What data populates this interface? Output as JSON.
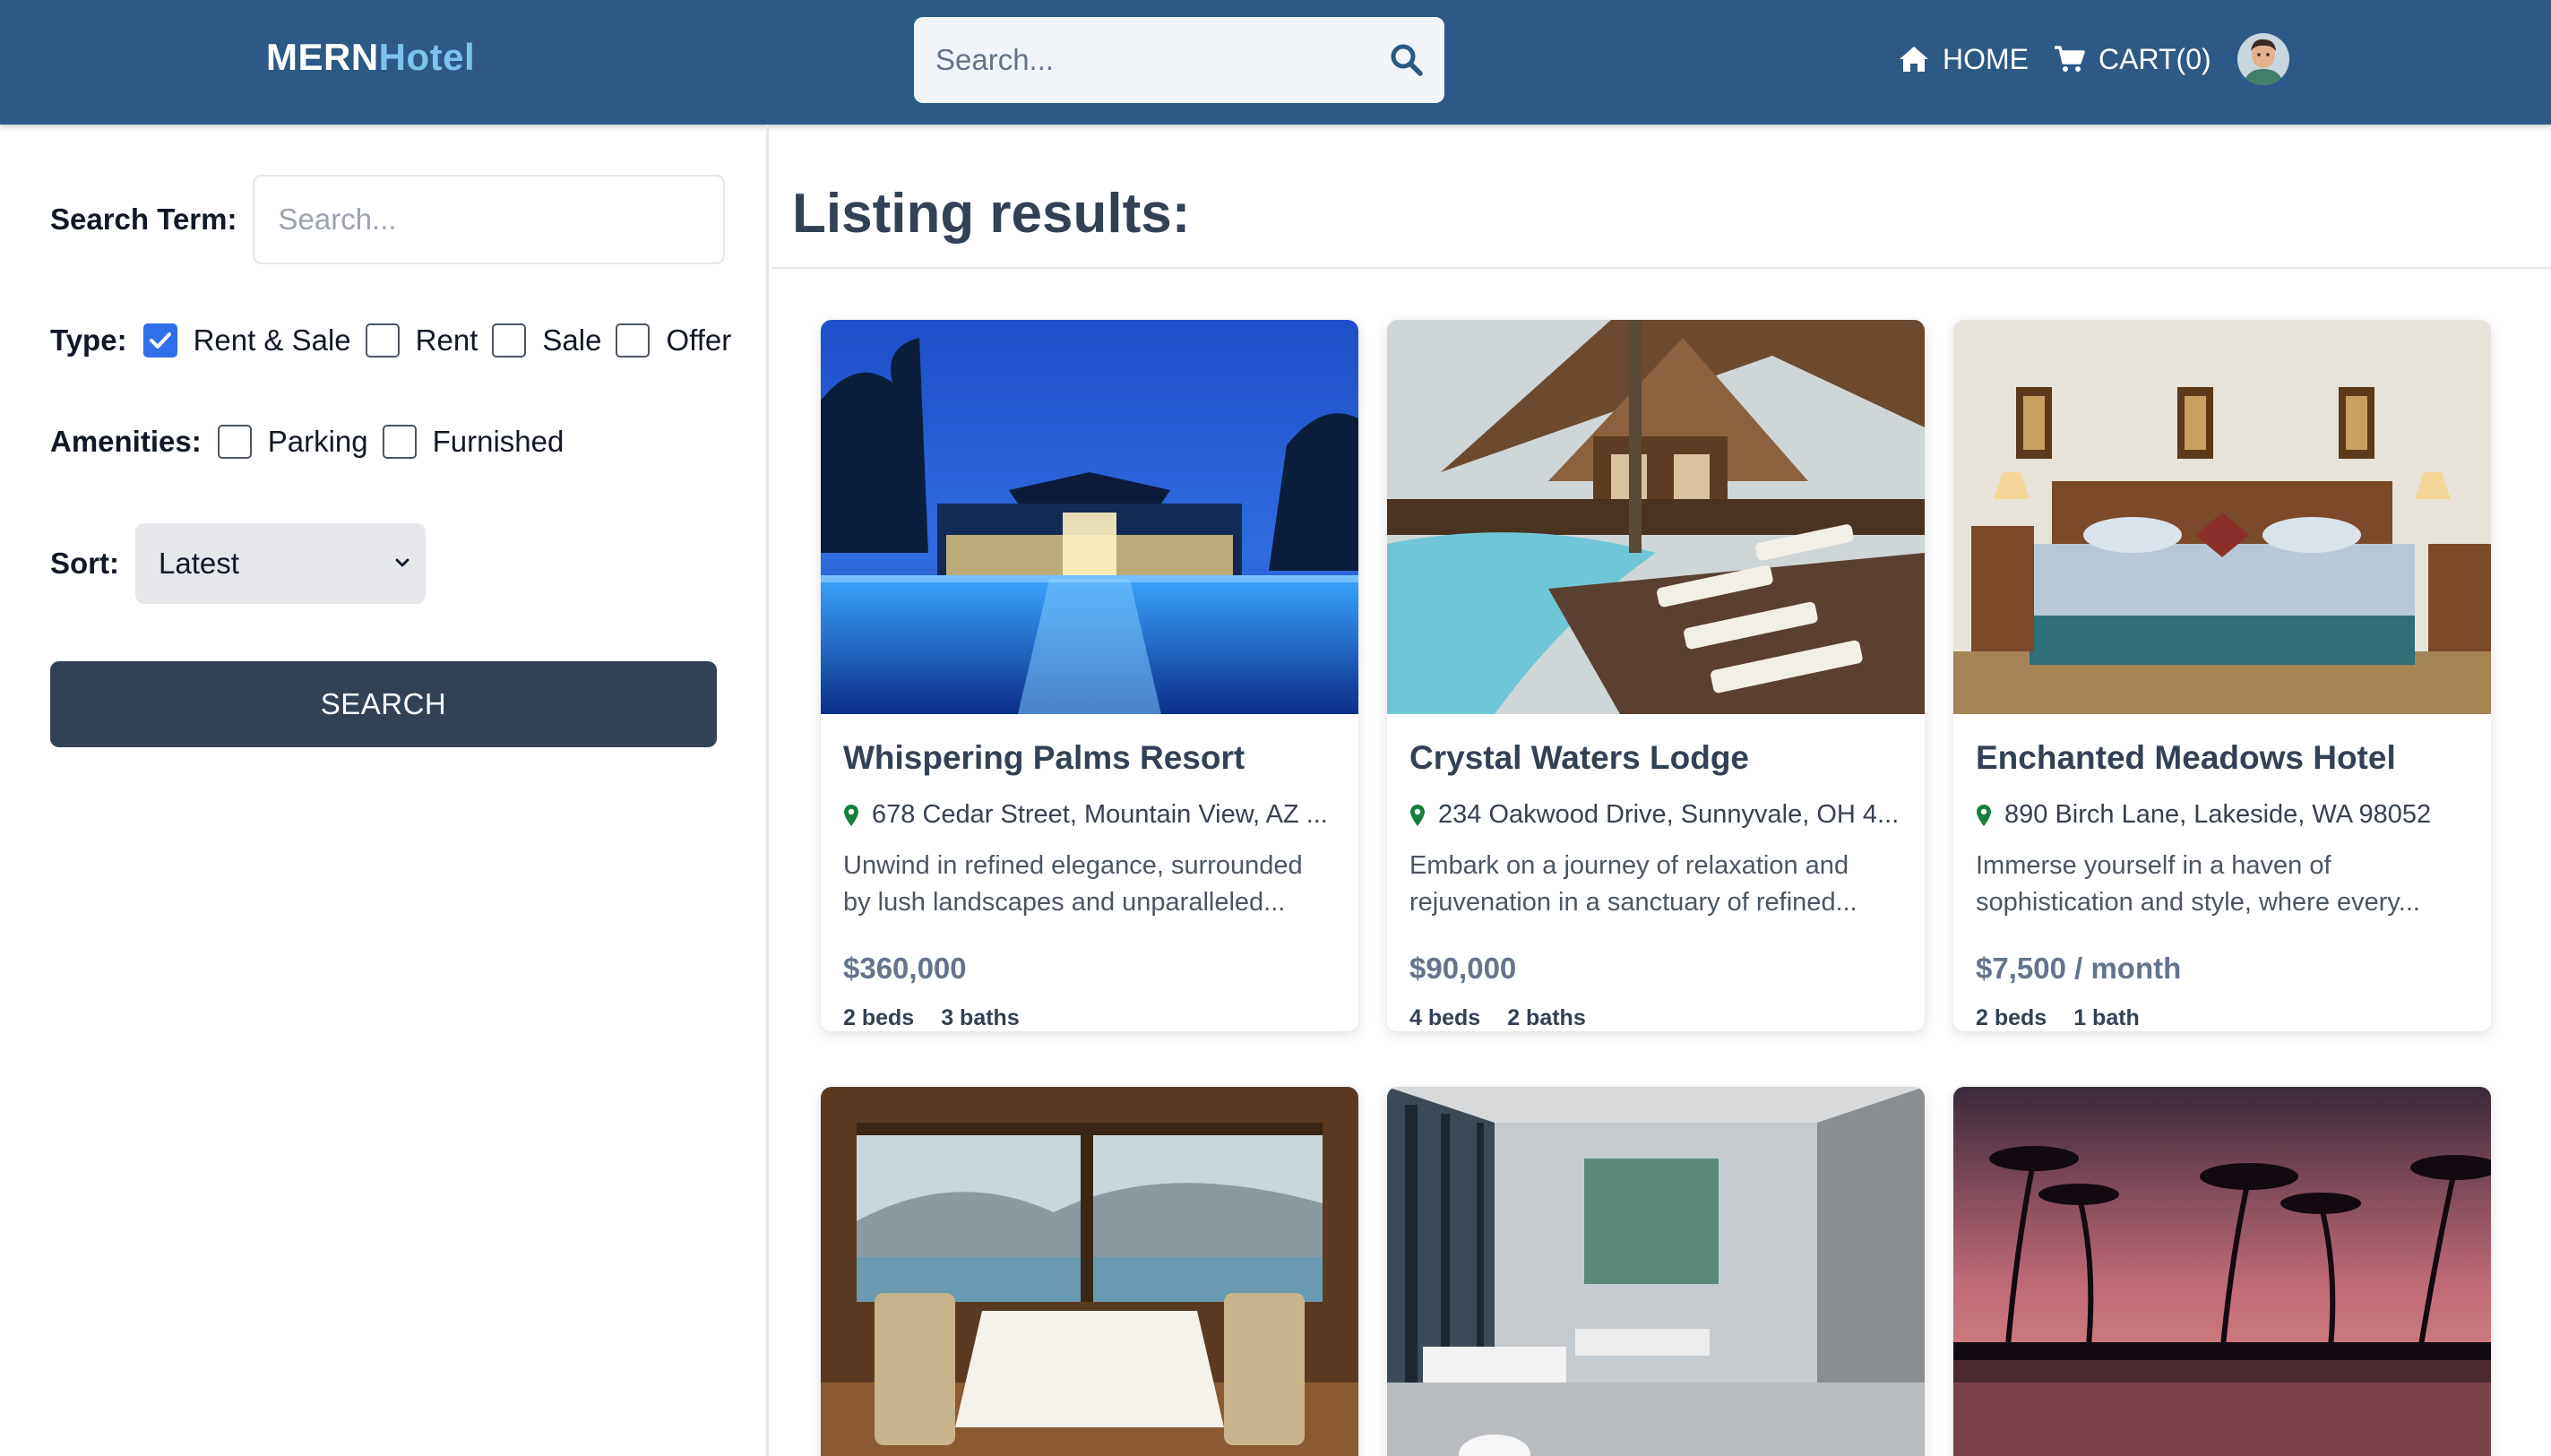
{
  "header": {
    "logo_part1": "MERN",
    "logo_part2": "Hotel",
    "search_placeholder": "Search...",
    "nav_home": "HOME",
    "nav_cart": "CART(0)"
  },
  "sidebar": {
    "search_term_label": "Search Term:",
    "search_placeholder": "Search...",
    "type_label": "Type:",
    "type_options": [
      {
        "label": "Rent & Sale",
        "checked": true
      },
      {
        "label": "Rent",
        "checked": false
      },
      {
        "label": "Sale",
        "checked": false
      },
      {
        "label": "Offer",
        "checked": false
      }
    ],
    "amenities_label": "Amenities:",
    "amenity_options": [
      {
        "label": "Parking",
        "checked": false
      },
      {
        "label": "Furnished",
        "checked": false
      }
    ],
    "sort_label": "Sort:",
    "sort_value": "Latest",
    "search_button": "SEARCH"
  },
  "main": {
    "title": "Listing results:",
    "listings": [
      {
        "title": "Whispering Palms Resort",
        "address": "678 Cedar Street, Mountain View, AZ ...",
        "description": "Unwind in refined elegance, surrounded by lush landscapes and unparalleled...",
        "price": "$360,000",
        "beds": "2 beds",
        "baths": "3 baths",
        "image": "resort-pool-night"
      },
      {
        "title": "Crystal Waters Lodge",
        "address": "234 Oakwood Drive, Sunnyvale, OH 4...",
        "description": "Embark on a journey of relaxation and rejuvenation in a sanctuary of refined...",
        "price": "$90,000",
        "beds": "4 beds",
        "baths": "2 baths",
        "image": "lodge-pool-loungers"
      },
      {
        "title": "Enchanted Meadows Hotel",
        "address": "890 Birch Lane, Lakeside, WA 98052",
        "description": "Immerse yourself in a haven of sophistication and style, where every...",
        "price": "$7,500 / month",
        "beds": "2 beds",
        "baths": "1 bath",
        "image": "hotel-bedroom"
      },
      {
        "image": "dining-room-harbor-view"
      },
      {
        "image": "modern-lobby-lounge"
      },
      {
        "image": "palm-trees-sunset"
      }
    ]
  },
  "colors": {
    "header_bg": "#2c5985",
    "logo_accent": "#7cc4ee",
    "button_bg": "#334155",
    "checkbox_checked": "#2f6fea",
    "pin_green": "#15803d"
  }
}
